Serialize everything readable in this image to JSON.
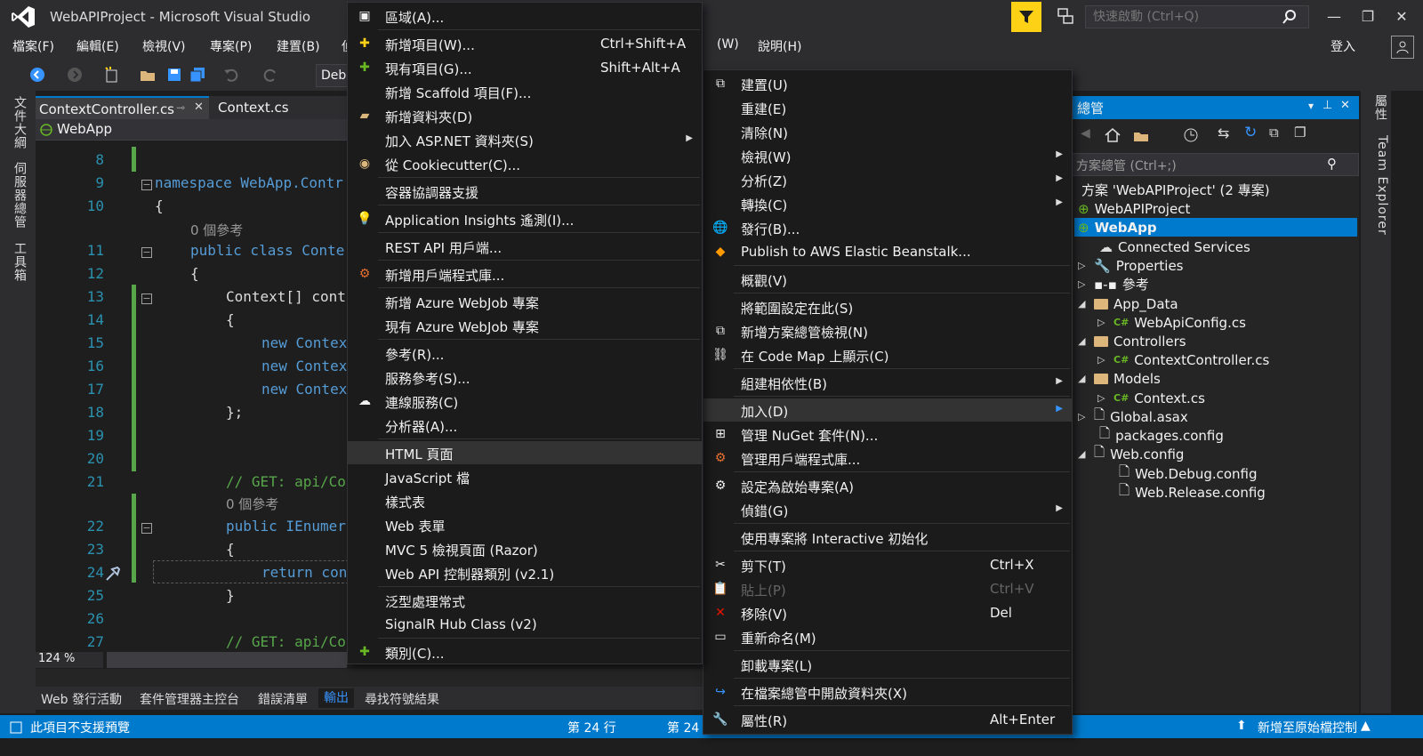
{
  "window": {
    "title": "WebAPIProject - Microsoft Visual Studio",
    "quick_launch_placeholder": "快速啟動 (Ctrl+Q)",
    "sign_in": "登入"
  },
  "menubar": {
    "items": [
      "檔案(F)",
      "編輯(E)",
      "檢視(V)",
      "專案(P)",
      "建置(B)",
      "偵",
      "(W)",
      "說明(H)"
    ]
  },
  "toolbar": {
    "config": "Debu"
  },
  "left_rail": {
    "tabs": [
      "文件大綱",
      "伺服器總管",
      "工具箱"
    ]
  },
  "editor": {
    "tabs": [
      "ContextController.cs",
      "Context.cs"
    ],
    "nav_project": "WebApp",
    "zoom": "124 %",
    "lines": [
      {
        "n": "8",
        "code": ""
      },
      {
        "n": "9",
        "code": "namespace WebApp.Contr"
      },
      {
        "n": "10",
        "code": "{"
      },
      {
        "n": "",
        "code": "0 個參考"
      },
      {
        "n": "11",
        "code": "public class Conte"
      },
      {
        "n": "12",
        "code": "{"
      },
      {
        "n": "13",
        "code": "Context[] cont"
      },
      {
        "n": "14",
        "code": "{"
      },
      {
        "n": "15",
        "code": "new Contex"
      },
      {
        "n": "16",
        "code": "new Contex"
      },
      {
        "n": "17",
        "code": "new Contex"
      },
      {
        "n": "18",
        "code": "};"
      },
      {
        "n": "19",
        "code": ""
      },
      {
        "n": "20",
        "code": ""
      },
      {
        "n": "21",
        "code": "// GET: api/Co"
      },
      {
        "n": "",
        "code": "0 個參考"
      },
      {
        "n": "22",
        "code": "public IEnumer"
      },
      {
        "n": "23",
        "code": "{"
      },
      {
        "n": "24",
        "code": "return con"
      },
      {
        "n": "25",
        "code": "}"
      },
      {
        "n": "26",
        "code": ""
      },
      {
        "n": "27",
        "code": "// GET: api/Co"
      }
    ]
  },
  "bottom_tabs": [
    "Web 發行活動",
    "套件管理器主控台",
    "錯誤清單",
    "輸出",
    "尋找符號結果"
  ],
  "statusbar": {
    "left": "此項目不支援預覽",
    "line": "第 24 行",
    "line2": "第 24",
    "right": "新增至原始檔控制"
  },
  "solution_explorer": {
    "title": "總管",
    "search_placeholder": "方案總管 (Ctrl+;)",
    "items": [
      {
        "label": "方案 'WebAPIProject' (2 專案)"
      },
      {
        "label": "WebAPIProject"
      },
      {
        "label": "WebApp"
      },
      {
        "label": "Connected Services"
      },
      {
        "label": "Properties"
      },
      {
        "label": "參考"
      },
      {
        "label": "App_Data"
      },
      {
        "label": "WebApiConfig.cs"
      },
      {
        "label": "Controllers"
      },
      {
        "label": "ContextController.cs"
      },
      {
        "label": "Models"
      },
      {
        "label": "Context.cs"
      },
      {
        "label": "Global.asax"
      },
      {
        "label": "packages.config"
      },
      {
        "label": "Web.config"
      },
      {
        "label": "Web.Debug.config"
      },
      {
        "label": "Web.Release.config"
      }
    ]
  },
  "right_rail": {
    "tabs": [
      "屬性",
      "Team Explorer"
    ]
  },
  "project_menu": {
    "items": [
      {
        "label": "建置(U)"
      },
      {
        "label": "重建(E)"
      },
      {
        "label": "清除(N)"
      },
      {
        "label": "檢視(W)"
      },
      {
        "label": "分析(Z)"
      },
      {
        "label": "轉換(C)"
      },
      {
        "label": "發行(B)..."
      },
      {
        "label": "Publish to AWS Elastic Beanstalk..."
      },
      {
        "label": "概觀(V)"
      },
      {
        "label": "將範圍設定在此(S)"
      },
      {
        "label": "新增方案總管檢視(N)"
      },
      {
        "label": "在 Code Map 上顯示(C)"
      },
      {
        "label": "組建相依性(B)"
      },
      {
        "label": "加入(D)"
      },
      {
        "label": "管理 NuGet 套件(N)..."
      },
      {
        "label": "管理用戶端程式庫..."
      },
      {
        "label": "設定為啟始專案(A)"
      },
      {
        "label": "偵錯(G)"
      },
      {
        "label": "使用專案將 Interactive 初始化"
      },
      {
        "label": "剪下(T)",
        "shortcut": "Ctrl+X"
      },
      {
        "label": "貼上(P)",
        "shortcut": "Ctrl+V"
      },
      {
        "label": "移除(V)",
        "shortcut": "Del"
      },
      {
        "label": "重新命名(M)"
      },
      {
        "label": "卸載專案(L)"
      },
      {
        "label": "在檔案總管中開啟資料夾(X)"
      },
      {
        "label": "屬性(R)",
        "shortcut": "Alt+Enter"
      }
    ]
  },
  "add_menu": {
    "items": [
      {
        "label": "區域(A)..."
      },
      {
        "label": "新增項目(W)...",
        "shortcut": "Ctrl+Shift+A"
      },
      {
        "label": "現有項目(G)...",
        "shortcut": "Shift+Alt+A"
      },
      {
        "label": "新增 Scaffold 項目(F)..."
      },
      {
        "label": "新增資料夾(D)"
      },
      {
        "label": "加入 ASP.NET 資料夾(S)"
      },
      {
        "label": "從 Cookiecutter(C)..."
      },
      {
        "label": "容器協調器支援"
      },
      {
        "label": "Application Insights 遙測(I)..."
      },
      {
        "label": "REST API 用戶端..."
      },
      {
        "label": "新增用戶端程式庫..."
      },
      {
        "label": "新增 Azure WebJob 專案"
      },
      {
        "label": "現有 Azure WebJob 專案"
      },
      {
        "label": "參考(R)..."
      },
      {
        "label": "服務參考(S)..."
      },
      {
        "label": "連線服務(C)"
      },
      {
        "label": "分析器(A)..."
      },
      {
        "label": "HTML 頁面"
      },
      {
        "label": "JavaScript 檔"
      },
      {
        "label": "樣式表"
      },
      {
        "label": "Web 表單"
      },
      {
        "label": "MVC 5 檢視頁面 (Razor)"
      },
      {
        "label": "Web API 控制器類別 (v2.1)"
      },
      {
        "label": "泛型處理常式"
      },
      {
        "label": "SignalR Hub Class (v2)"
      },
      {
        "label": "類別(C)..."
      }
    ]
  },
  "colors": {
    "accent": "#007acc",
    "menu_bg": "#1b1b1c",
    "chrome_bg": "#2d2d30",
    "filter_button": "#fcd116"
  }
}
